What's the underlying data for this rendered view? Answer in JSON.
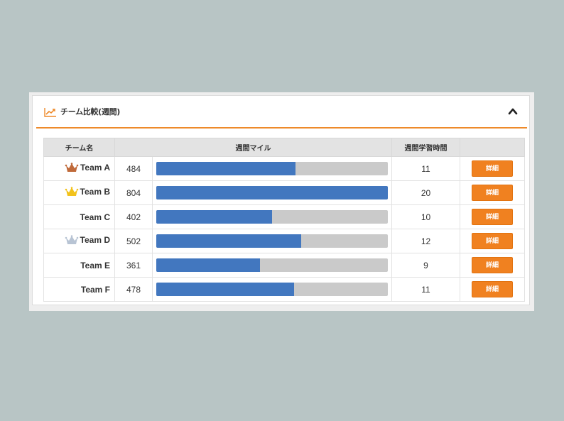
{
  "panel": {
    "title": "チーム比較(週間)",
    "icon": "line-chart-icon",
    "collapse_icon": "chevron-up-icon",
    "accent_color": "#ee8a2a"
  },
  "table": {
    "headers": {
      "team": "チーム名",
      "miles": "週間マイル",
      "hours": "週間学習時間",
      "action": ""
    },
    "max_miles": 804,
    "bar_color": "#4277bf",
    "detail_label": "詳細",
    "rows": [
      {
        "team": "Team A",
        "miles": "484",
        "miles_value": 484,
        "hours": "11",
        "crown": "bronze"
      },
      {
        "team": "Team B",
        "miles": "804",
        "miles_value": 804,
        "hours": "20",
        "crown": "gold"
      },
      {
        "team": "Team C",
        "miles": "402",
        "miles_value": 402,
        "hours": "10",
        "crown": "none"
      },
      {
        "team": "Team D",
        "miles": "502",
        "miles_value": 502,
        "hours": "12",
        "crown": "silver"
      },
      {
        "team": "Team E",
        "miles": "361",
        "miles_value": 361,
        "hours": "9",
        "crown": "none"
      },
      {
        "team": "Team F",
        "miles": "478",
        "miles_value": 478,
        "hours": "11",
        "crown": "none"
      }
    ]
  },
  "crown_colors": {
    "gold": "#f2c21b",
    "silver": "#b8c4d4",
    "bronze": "#c06a3a"
  }
}
